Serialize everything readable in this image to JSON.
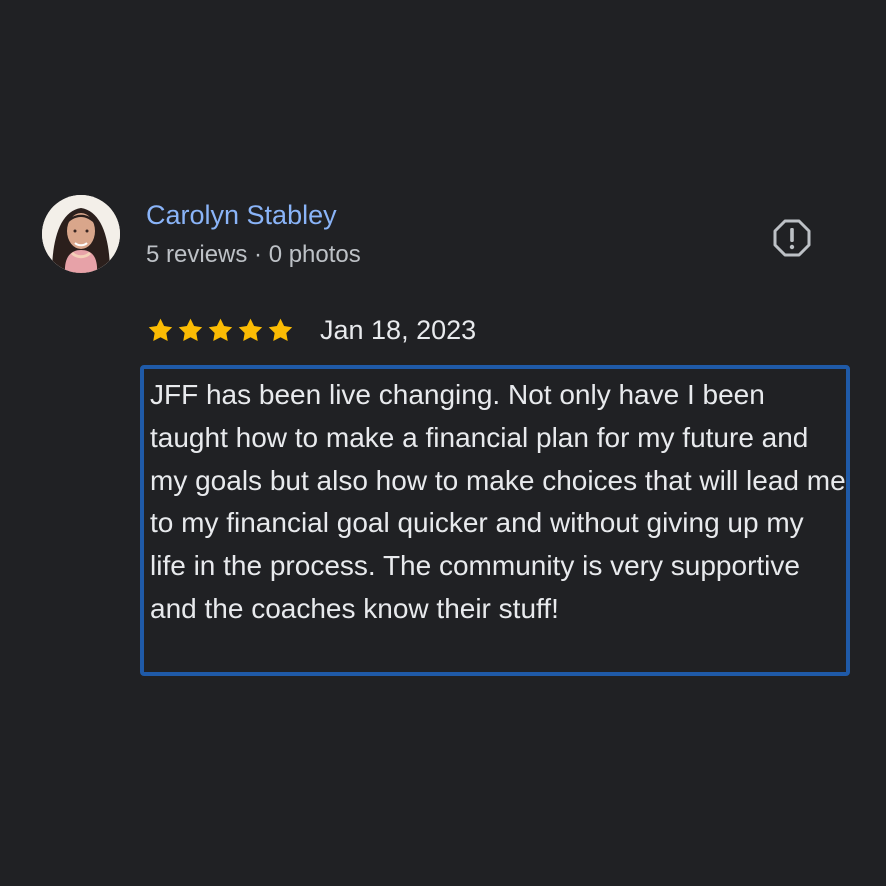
{
  "review": {
    "reviewer_name": "Carolyn Stabley",
    "reviewer_meta": "5 reviews · 0 photos",
    "rating": 5,
    "rating_max": 5,
    "date": "Jan 18, 2023",
    "text": "JFF has been live changing. Not only have I been taught how to make a financial plan for my future and my goals but also how to make choices that will lead me to my financial goal quicker and without giving up my life in the process. The community is very supportive and the coaches know their stuff!"
  },
  "icons": {
    "avatar": "avatar-photo",
    "report": "report-icon",
    "star": "star-icon"
  },
  "colors": {
    "background": "#202124",
    "name": "#8ab4f8",
    "meta": "#bdc1c6",
    "text": "#e8eaed",
    "star": "#fbbc04",
    "highlight_border": "#1f5aa8",
    "icon": "#bdc1c6"
  }
}
